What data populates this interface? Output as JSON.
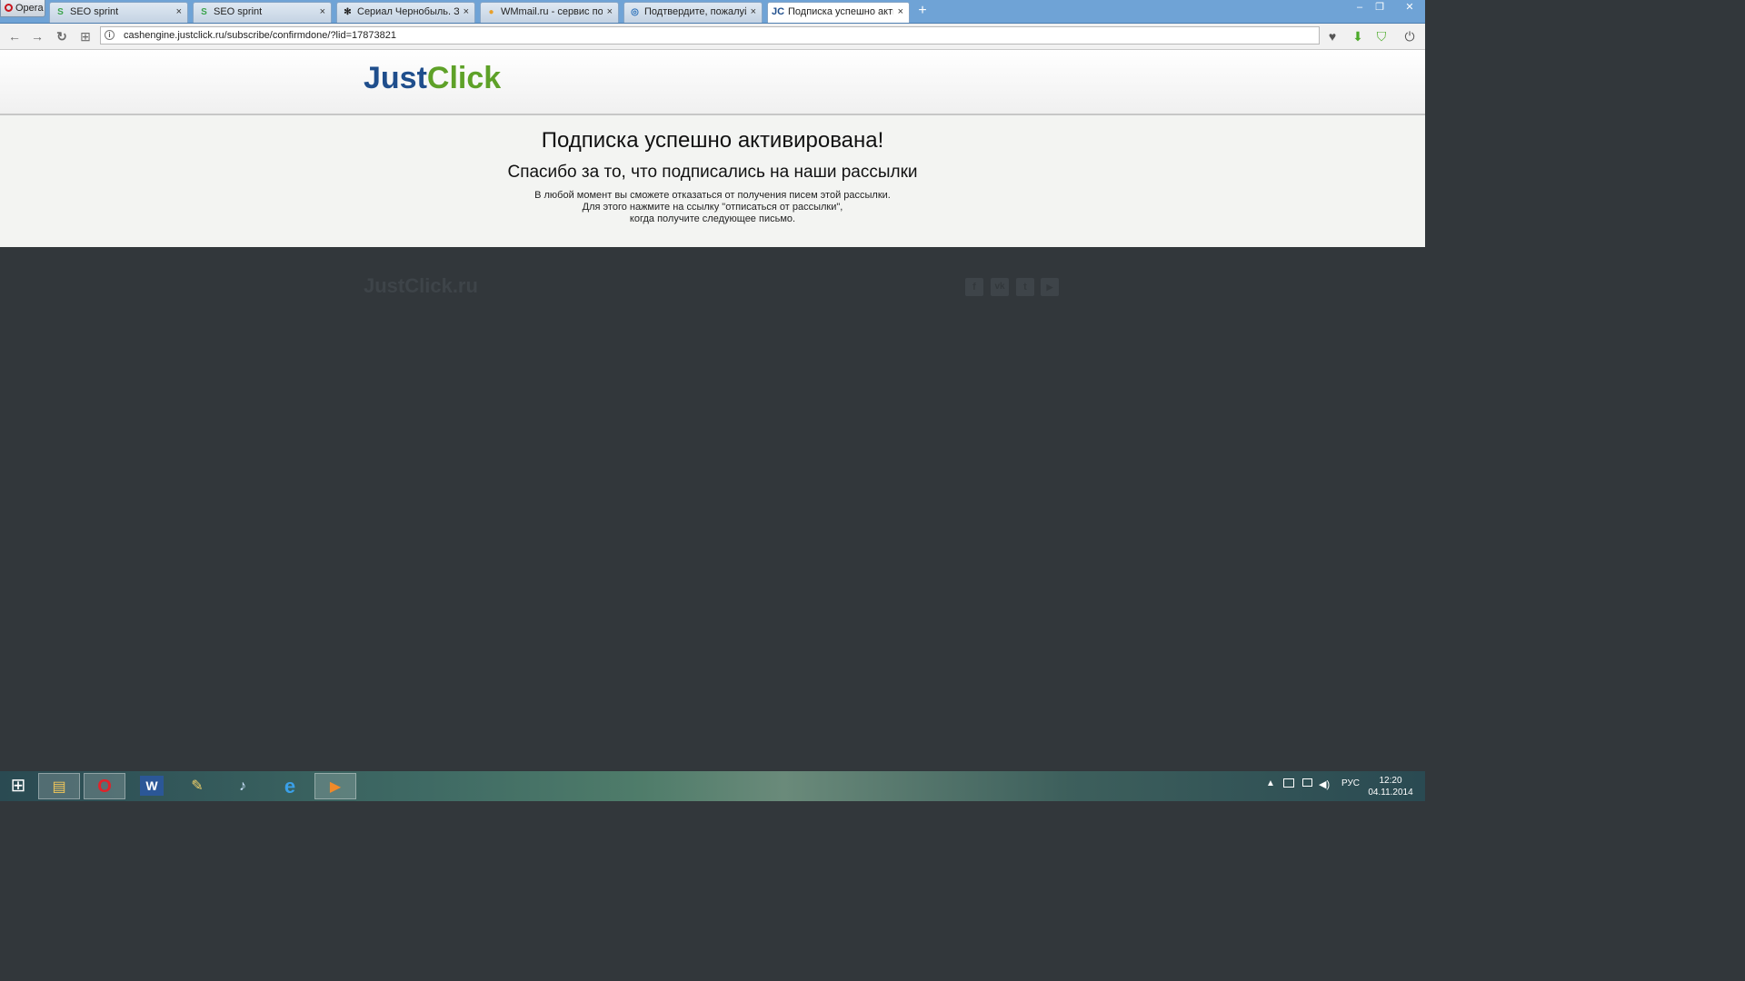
{
  "browser": {
    "menu_label": "Opera",
    "tabs": [
      {
        "title": "SEO sprint",
        "favicon": "S",
        "favicon_color": "#3aa34b"
      },
      {
        "title": "SEO sprint",
        "favicon": "S",
        "favicon_color": "#3aa34b"
      },
      {
        "title": "Сериал Чернобыль. Зона",
        "favicon": "✻",
        "favicon_color": "#222222"
      },
      {
        "title": "WMmail.ru - сервис почт",
        "favicon": "●",
        "favicon_color": "#e8a02a"
      },
      {
        "title": "Подтвердите, пожалуйста",
        "favicon": "◎",
        "favicon_color": "#2a6fb8"
      },
      {
        "title": "Подписка успешно актив",
        "favicon": "JC",
        "favicon_color": "#1f4e8c"
      }
    ],
    "close_glyph": "×",
    "new_tab_glyph": "+",
    "window_controls": {
      "minimize": "–",
      "restore": "❐",
      "close": "✕"
    },
    "nav": {
      "back": "←",
      "forward": "→",
      "reload": "↻",
      "speed_dial": "⊞"
    },
    "address": "cashengine.justclick.ru/subscribe/confirmdone/?lid=17873821",
    "info_glyph": "i",
    "extensions": {
      "heart": "♥",
      "download": "⬇",
      "shield": "⛉",
      "power": "⏻"
    }
  },
  "page": {
    "logo_part1": "Just",
    "logo_part2": "Click",
    "heading": "Подписка успешно активирована!",
    "subheading": "Спасибо за то, что подписались на наши рассылки",
    "note_line1": "В любой момент вы сможете отказаться от получения писем этой рассылки.",
    "note_line2": "Для этого нажмите на ссылку \"отписаться от рассылки\",",
    "note_line3": "когда получите следующее письмо.",
    "footer_logo": "JustClick.ru",
    "social": {
      "facebook": "f",
      "vk": "vk",
      "twitter": "t",
      "youtube": "▶"
    }
  },
  "taskbar": {
    "start": "⊞",
    "apps": {
      "explorer": "▤",
      "opera": "O",
      "word": "W",
      "paint": "✎",
      "sound": "♪",
      "ie": "e",
      "media": "▶"
    },
    "tray_arrow": "▲",
    "language": "РУС",
    "time": "12:20",
    "date": "04.11.2014"
  },
  "colors": {
    "brand_blue": "#1f4e8c",
    "brand_green": "#5ea128",
    "footer_bg": "#32373b"
  }
}
